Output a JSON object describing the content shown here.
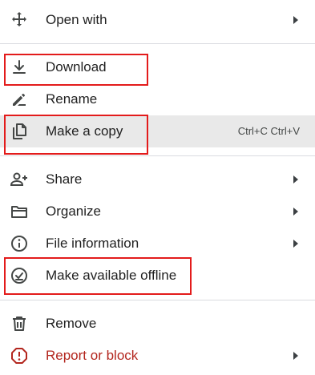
{
  "menu": {
    "items": [
      {
        "label": "Open with",
        "icon": "move-arrows-icon",
        "has_submenu": true
      },
      {
        "label": "Download",
        "icon": "download-icon"
      },
      {
        "label": "Rename",
        "icon": "pencil-icon"
      },
      {
        "label": "Make a copy",
        "icon": "copy-icon",
        "shortcut": "Ctrl+C Ctrl+V",
        "hovered": true
      },
      {
        "label": "Share",
        "icon": "person-add-icon",
        "has_submenu": true
      },
      {
        "label": "Organize",
        "icon": "folder-icon",
        "has_submenu": true
      },
      {
        "label": "File information",
        "icon": "info-icon",
        "has_submenu": true
      },
      {
        "label": "Make available offline",
        "icon": "offline-check-icon"
      },
      {
        "label": "Remove",
        "icon": "trash-icon"
      },
      {
        "label": "Report or block",
        "icon": "report-icon",
        "has_submenu": true
      }
    ]
  },
  "highlights": [
    "Download",
    "Make a copy",
    "Make available offline"
  ],
  "colors": {
    "hover_bg": "#e9e9e9",
    "highlight_border": "#e31b1b",
    "danger": "#b3261e",
    "divider": "#dadce0"
  }
}
